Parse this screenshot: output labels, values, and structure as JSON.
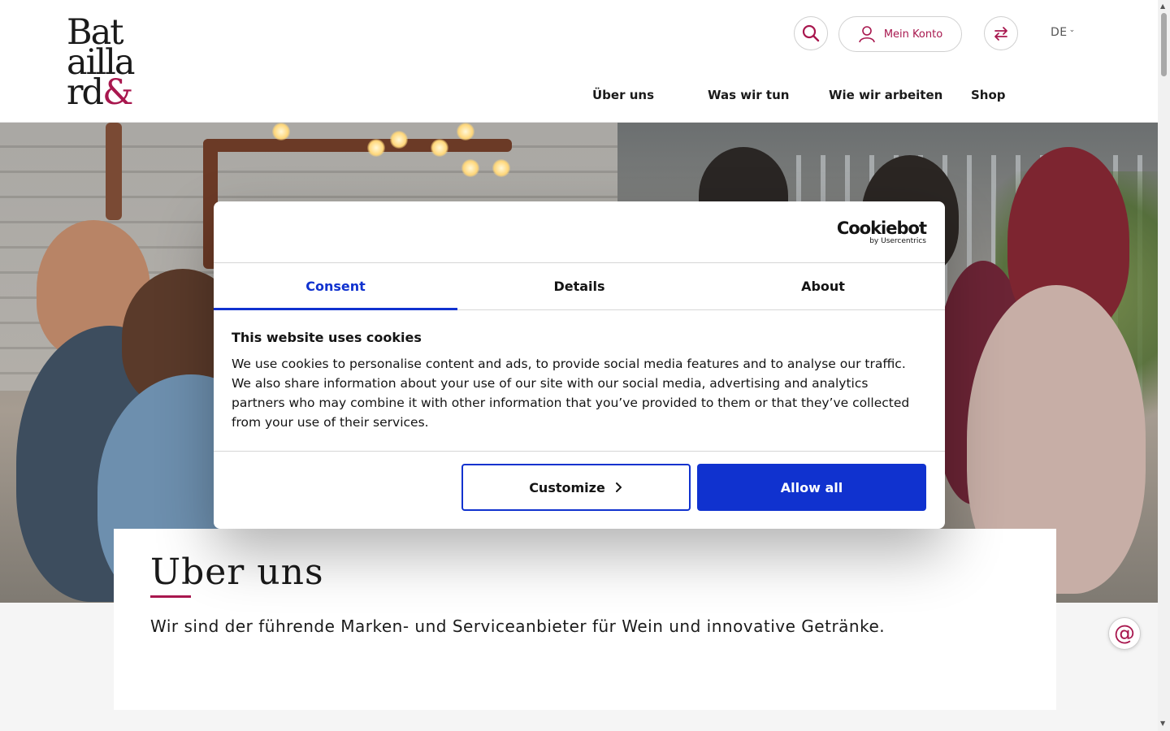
{
  "brand": {
    "logo_lines": [
      "Bat",
      "ailla",
      "rd"
    ],
    "logo_ampersand": "&",
    "accent_color": "#a8174e"
  },
  "header": {
    "search_icon": "search-icon",
    "account_label": "Mein Konto",
    "account_icon": "user-icon",
    "switch_icon": "swap-arrows-icon",
    "language": "DE",
    "nav": [
      "Über uns",
      "Was wir tun",
      "Wie wir arbeiten",
      "Shop"
    ]
  },
  "page": {
    "title": "Uber uns",
    "lead": "Wir sind der führende Marken- und Serviceanbieter für Wein und innovative Getränke.",
    "contact_icon": "at-sign-icon",
    "contact_symbol": "@"
  },
  "cookie_dialog": {
    "provider": "Cookiebot",
    "provider_sub": "by Usercentrics",
    "tabs": [
      "Consent",
      "Details",
      "About"
    ],
    "active_tab": "Consent",
    "heading": "This website uses cookies",
    "body": "We use cookies to personalise content and ads, to provide social media features and to analyse our traffic. We also share information about your use of our site with our social media, advertising and analytics partners who may combine it with other information that you’ve provided to them or that they’ve collected from your use of their services.",
    "customize_label": "Customize",
    "allow_label": "Allow all",
    "button_color": "#1032cf"
  }
}
